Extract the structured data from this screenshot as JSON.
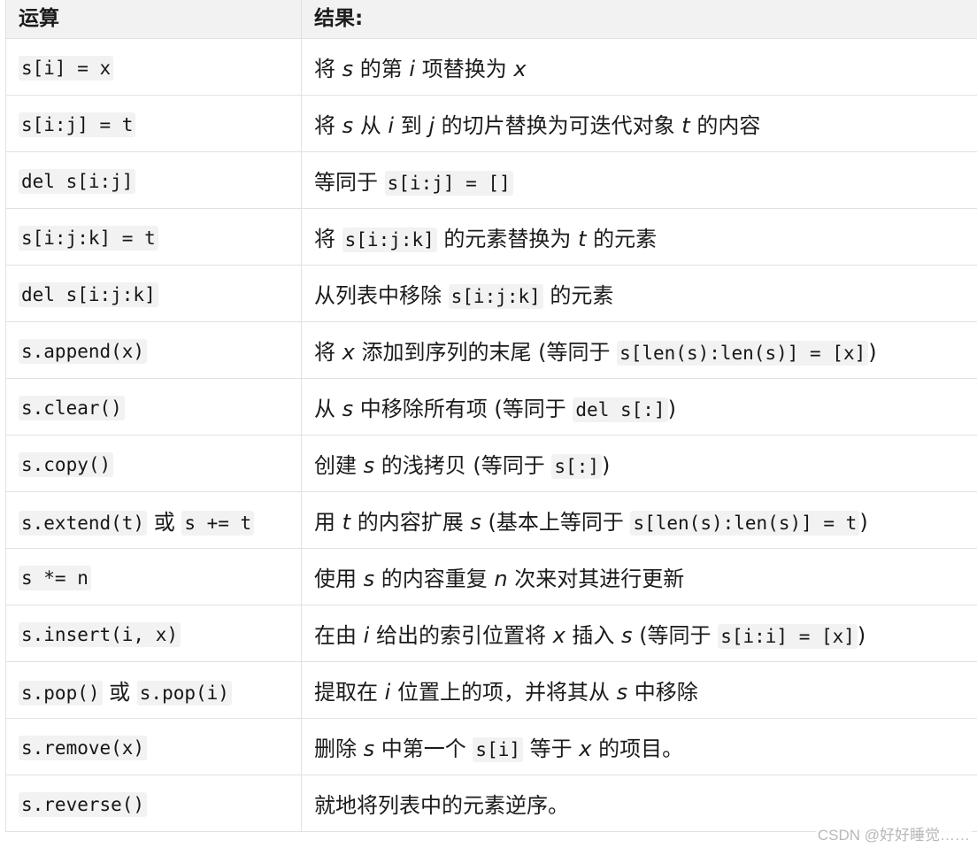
{
  "table": {
    "headers": [
      "运算",
      "结果:"
    ],
    "rows": [
      {
        "op": [
          {
            "code": "s[i] = x"
          }
        ],
        "result": [
          {
            "t": "将 "
          },
          {
            "i": "s"
          },
          {
            "t": " 的第 "
          },
          {
            "i": "i"
          },
          {
            "t": " 项替换为 "
          },
          {
            "i": "x"
          }
        ]
      },
      {
        "op": [
          {
            "code": "s[i:j] = t"
          }
        ],
        "result": [
          {
            "t": "将 "
          },
          {
            "i": "s"
          },
          {
            "t": " 从 "
          },
          {
            "i": "i"
          },
          {
            "t": " 到 "
          },
          {
            "i": "j"
          },
          {
            "t": " 的切片替换为可迭代对象 "
          },
          {
            "i": "t"
          },
          {
            "t": " 的内容"
          }
        ]
      },
      {
        "op": [
          {
            "code": "del s[i:j]"
          }
        ],
        "result": [
          {
            "t": "等同于 "
          },
          {
            "code": "s[i:j] = []"
          }
        ]
      },
      {
        "op": [
          {
            "code": "s[i:j:k] = t"
          }
        ],
        "result": [
          {
            "t": "将 "
          },
          {
            "code": "s[i:j:k]"
          },
          {
            "t": " 的元素替换为 "
          },
          {
            "i": "t"
          },
          {
            "t": " 的元素"
          }
        ]
      },
      {
        "op": [
          {
            "code": "del s[i:j:k]"
          }
        ],
        "result": [
          {
            "t": "从列表中移除 "
          },
          {
            "code": "s[i:j:k]"
          },
          {
            "t": " 的元素"
          }
        ]
      },
      {
        "op": [
          {
            "code": "s.append(x)"
          }
        ],
        "result": [
          {
            "t": "将 "
          },
          {
            "i": "x"
          },
          {
            "t": " 添加到序列的末尾 (等同于 "
          },
          {
            "code": "s[len(s):len(s)] = [x]"
          },
          {
            "t": ")"
          }
        ]
      },
      {
        "op": [
          {
            "code": "s.clear()"
          }
        ],
        "result": [
          {
            "t": "从 "
          },
          {
            "i": "s"
          },
          {
            "t": " 中移除所有项 (等同于 "
          },
          {
            "code": "del s[:]"
          },
          {
            "t": ")"
          }
        ]
      },
      {
        "op": [
          {
            "code": "s.copy()"
          }
        ],
        "result": [
          {
            "t": "创建 "
          },
          {
            "i": "s"
          },
          {
            "t": " 的浅拷贝 (等同于 "
          },
          {
            "code": "s[:]"
          },
          {
            "t": ")"
          }
        ]
      },
      {
        "op": [
          {
            "code": "s.extend(t)"
          },
          {
            "t": " 或 "
          },
          {
            "code": "s += t"
          }
        ],
        "result": [
          {
            "t": "用 "
          },
          {
            "i": "t"
          },
          {
            "t": " 的内容扩展 "
          },
          {
            "i": "s"
          },
          {
            "t": " (基本上等同于 "
          },
          {
            "code": "s[len(s):len(s)] = t"
          },
          {
            "t": ")"
          }
        ]
      },
      {
        "op": [
          {
            "code": "s *= n"
          }
        ],
        "result": [
          {
            "t": "使用 "
          },
          {
            "i": "s"
          },
          {
            "t": " 的内容重复 "
          },
          {
            "i": "n"
          },
          {
            "t": " 次来对其进行更新"
          }
        ]
      },
      {
        "op": [
          {
            "code": "s.insert(i, x)"
          }
        ],
        "result": [
          {
            "t": "在由 "
          },
          {
            "i": "i"
          },
          {
            "t": " 给出的索引位置将 "
          },
          {
            "i": "x"
          },
          {
            "t": " 插入 "
          },
          {
            "i": "s"
          },
          {
            "t": " (等同于 "
          },
          {
            "code": "s[i:i] = [x]"
          },
          {
            "t": ")"
          }
        ]
      },
      {
        "op": [
          {
            "code": "s.pop()"
          },
          {
            "t": " 或 "
          },
          {
            "code": "s.pop(i)"
          }
        ],
        "result": [
          {
            "t": "提取在 "
          },
          {
            "i": "i"
          },
          {
            "t": " 位置上的项，并将其从 "
          },
          {
            "i": "s"
          },
          {
            "t": " 中移除"
          }
        ]
      },
      {
        "op": [
          {
            "code": "s.remove(x)"
          }
        ],
        "result": [
          {
            "t": "删除 "
          },
          {
            "i": "s"
          },
          {
            "t": " 中第一个 "
          },
          {
            "code": "s[i]"
          },
          {
            "t": " 等于 "
          },
          {
            "i": "x"
          },
          {
            "t": " 的项目。"
          }
        ]
      },
      {
        "op": [
          {
            "code": "s.reverse()"
          }
        ],
        "result": [
          {
            "t": "就地将列表中的元素逆序。"
          }
        ]
      }
    ]
  },
  "watermark": "CSDN @好好睡觉……"
}
